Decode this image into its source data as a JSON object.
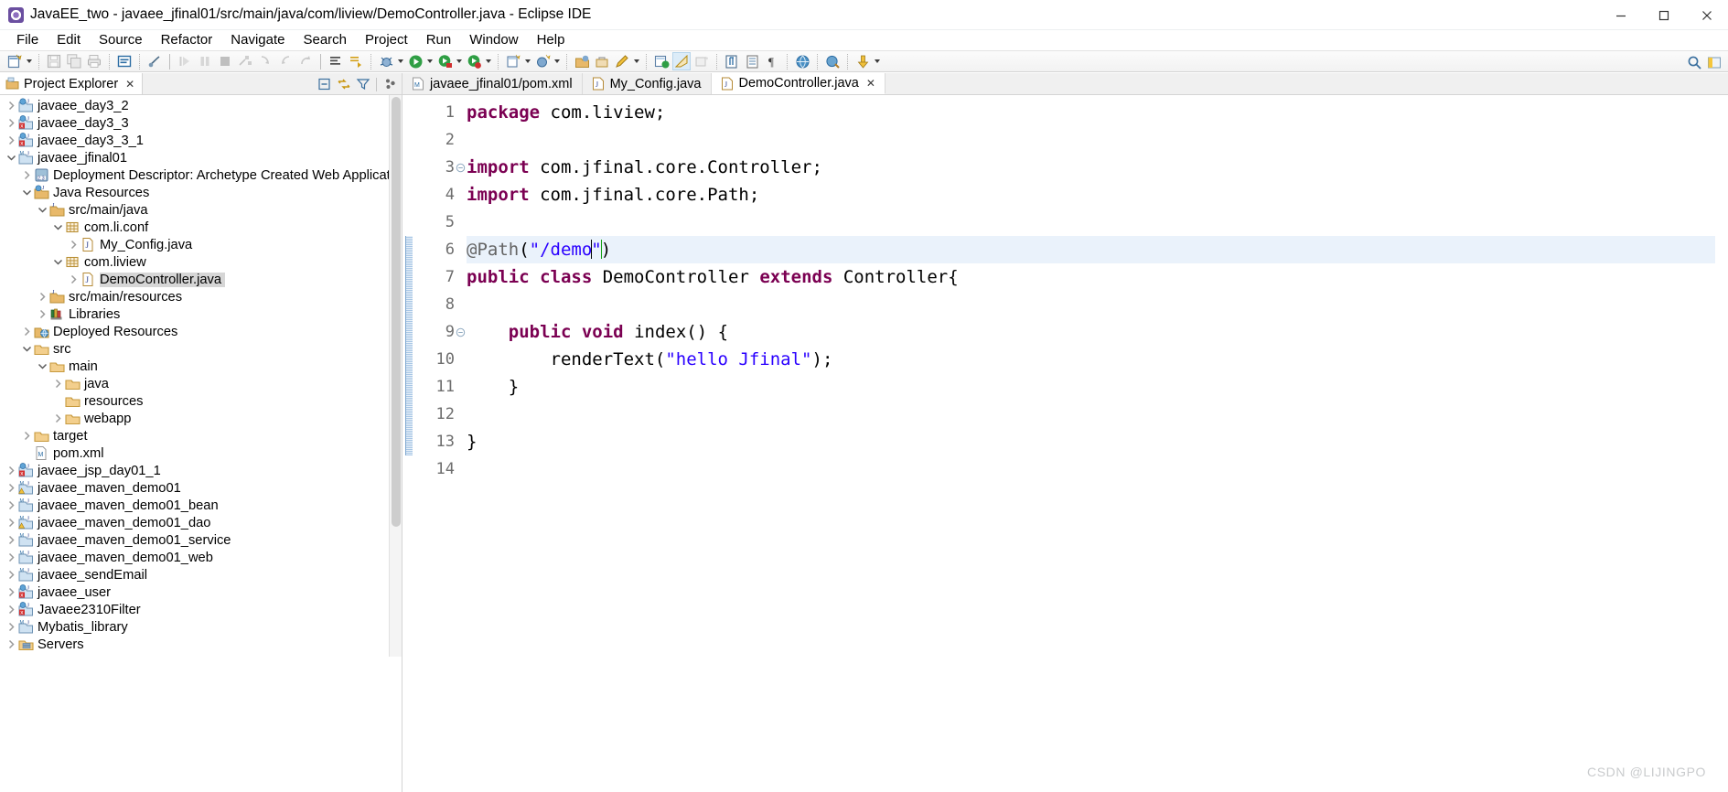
{
  "window": {
    "title": "JavaEE_two - javaee_jfinal01/src/main/java/com/liview/DemoController.java - Eclipse IDE",
    "app_icon": "eclipse-icon",
    "controls": {
      "minimize": "minimize-icon",
      "maximize": "maximize-icon",
      "close": "close-icon"
    }
  },
  "menubar": {
    "items": [
      {
        "label": "File"
      },
      {
        "label": "Edit"
      },
      {
        "label": "Source"
      },
      {
        "label": "Refactor"
      },
      {
        "label": "Navigate"
      },
      {
        "label": "Search"
      },
      {
        "label": "Project"
      },
      {
        "label": "Run"
      },
      {
        "label": "Window"
      },
      {
        "label": "Help"
      }
    ]
  },
  "toolbar": {
    "icons": [
      "new-wizard-icon",
      "save-icon",
      "save-all-icon",
      "print-icon",
      "toggle-mark-occurrences-icon",
      "link-with-editor-icon",
      "resume-icon",
      "suspend-icon",
      "terminate-icon",
      "disconnect-icon",
      "step-into-icon",
      "step-over-icon",
      "step-return-icon",
      "last-edit-location-icon",
      "next-annotation-icon",
      "debug-icon",
      "run-icon",
      "run-as-icon",
      "coverage-icon",
      "new-java-project-icon",
      "new-java-class-icon",
      "open-type-icon",
      "open-task-icon",
      "external-tools-icon",
      "search-icon",
      "pencil-icon",
      "build-icon",
      "java-browsing-icon",
      "java-perspective-icon",
      "pilcrow-icon",
      "web-browser-icon",
      "open-web-perspective-icon",
      "download-icon"
    ],
    "search_icon": "search-icon",
    "perspective_icon": "open-perspective-icon"
  },
  "project_explorer": {
    "tab_label": "Project Explorer",
    "tab_icon": "project-explorer-icon",
    "tab_close": "close-icon",
    "tools": [
      "collapse-all-icon",
      "link-with-editor-icon",
      "filter-icon",
      "view-menu-icon"
    ],
    "items": [
      {
        "label": "javaee_day3_2",
        "indent": 0,
        "twisty": "collapsed",
        "icon": "web-project-icon"
      },
      {
        "label": "javaee_day3_3",
        "indent": 0,
        "twisty": "collapsed",
        "icon": "web-project-error-icon"
      },
      {
        "label": "javaee_day3_3_1",
        "indent": 0,
        "twisty": "collapsed",
        "icon": "web-project-error-icon"
      },
      {
        "label": "javaee_jfinal01",
        "indent": 0,
        "twisty": "expanded",
        "icon": "maven-project-icon"
      },
      {
        "label": "Deployment Descriptor: Archetype Created Web Application",
        "indent": 1,
        "twisty": "collapsed",
        "icon": "deployment-descriptor-icon"
      },
      {
        "label": "Java Resources",
        "indent": 1,
        "twisty": "expanded",
        "icon": "java-resources-icon"
      },
      {
        "label": "src/main/java",
        "indent": 2,
        "twisty": "expanded",
        "icon": "source-folder-icon"
      },
      {
        "label": "com.li.conf",
        "indent": 3,
        "twisty": "expanded",
        "icon": "package-icon"
      },
      {
        "label": "My_Config.java",
        "indent": 4,
        "twisty": "collapsed",
        "icon": "java-file-icon"
      },
      {
        "label": "com.liview",
        "indent": 3,
        "twisty": "expanded",
        "icon": "package-icon"
      },
      {
        "label": "DemoController.java",
        "indent": 4,
        "twisty": "collapsed",
        "icon": "java-file-icon",
        "selected": true
      },
      {
        "label": "src/main/resources",
        "indent": 2,
        "twisty": "collapsed",
        "icon": "source-folder-icon"
      },
      {
        "label": "Libraries",
        "indent": 2,
        "twisty": "collapsed",
        "icon": "libraries-icon"
      },
      {
        "label": "Deployed Resources",
        "indent": 1,
        "twisty": "collapsed",
        "icon": "deployed-resources-icon"
      },
      {
        "label": "src",
        "indent": 1,
        "twisty": "expanded",
        "icon": "folder-icon"
      },
      {
        "label": "main",
        "indent": 2,
        "twisty": "expanded",
        "icon": "folder-icon"
      },
      {
        "label": "java",
        "indent": 3,
        "twisty": "collapsed",
        "icon": "folder-icon"
      },
      {
        "label": "resources",
        "indent": 3,
        "twisty": "none",
        "icon": "folder-icon"
      },
      {
        "label": "webapp",
        "indent": 3,
        "twisty": "collapsed",
        "icon": "folder-icon"
      },
      {
        "label": "target",
        "indent": 1,
        "twisty": "collapsed",
        "icon": "folder-icon"
      },
      {
        "label": "pom.xml",
        "indent": 1,
        "twisty": "none",
        "icon": "maven-pom-icon"
      },
      {
        "label": "javaee_jsp_day01_1",
        "indent": 0,
        "twisty": "collapsed",
        "icon": "web-project-error-icon"
      },
      {
        "label": "javaee_maven_demo01",
        "indent": 0,
        "twisty": "collapsed",
        "icon": "maven-project-warn-icon"
      },
      {
        "label": "javaee_maven_demo01_bean",
        "indent": 0,
        "twisty": "collapsed",
        "icon": "maven-project-icon"
      },
      {
        "label": "javaee_maven_demo01_dao",
        "indent": 0,
        "twisty": "collapsed",
        "icon": "maven-project-warn-icon"
      },
      {
        "label": "javaee_maven_demo01_service",
        "indent": 0,
        "twisty": "collapsed",
        "icon": "maven-project-icon"
      },
      {
        "label": "javaee_maven_demo01_web",
        "indent": 0,
        "twisty": "collapsed",
        "icon": "maven-project-icon"
      },
      {
        "label": "javaee_sendEmail",
        "indent": 0,
        "twisty": "collapsed",
        "icon": "maven-project-icon"
      },
      {
        "label": "javaee_user",
        "indent": 0,
        "twisty": "collapsed",
        "icon": "web-project-error-icon"
      },
      {
        "label": "Javaee2310Filter",
        "indent": 0,
        "twisty": "collapsed",
        "icon": "web-project-error-icon"
      },
      {
        "label": "Mybatis_library",
        "indent": 0,
        "twisty": "collapsed",
        "icon": "maven-project-icon"
      },
      {
        "label": "Servers",
        "indent": 0,
        "twisty": "collapsed",
        "icon": "servers-folder-icon"
      }
    ]
  },
  "editor": {
    "tabs": [
      {
        "label": "javaee_jfinal01/pom.xml",
        "icon": "maven-pom-icon",
        "active": false,
        "closable": false
      },
      {
        "label": "My_Config.java",
        "icon": "java-file-icon",
        "active": false,
        "closable": false
      },
      {
        "label": "DemoController.java",
        "icon": "java-file-icon",
        "active": true,
        "closable": true,
        "close_icon": "close-icon"
      }
    ],
    "line_numbers": [
      "1",
      "2",
      "3",
      "4",
      "5",
      "6",
      "7",
      "8",
      "9",
      "10",
      "11",
      "12",
      "13",
      "14"
    ],
    "fold_lines": [
      3,
      9
    ],
    "highlight_line": 6,
    "code_lines": [
      {
        "n": 1,
        "segments": [
          {
            "t": "package",
            "c": "kw"
          },
          {
            "t": " com.liview;",
            "c": ""
          }
        ]
      },
      {
        "n": 2,
        "segments": [
          {
            "t": "",
            "c": ""
          }
        ]
      },
      {
        "n": 3,
        "segments": [
          {
            "t": "import",
            "c": "kw"
          },
          {
            "t": " com.jfinal.core.Controller;",
            "c": ""
          }
        ]
      },
      {
        "n": 4,
        "segments": [
          {
            "t": "import",
            "c": "kw"
          },
          {
            "t": " com.jfinal.core.Path;",
            "c": ""
          }
        ]
      },
      {
        "n": 5,
        "segments": [
          {
            "t": "",
            "c": ""
          }
        ]
      },
      {
        "n": 6,
        "segments": [
          {
            "t": "@Path",
            "c": "annotated"
          },
          {
            "t": "(",
            "c": ""
          },
          {
            "t": "\"/demo",
            "c": "str"
          },
          {
            "t": "|CARET|",
            "c": "caret"
          },
          {
            "t": "\"",
            "c": "str"
          },
          {
            "t": "|CARET2|",
            "c": "caret2"
          },
          {
            "t": ")",
            "c": ""
          }
        ]
      },
      {
        "n": 7,
        "segments": [
          {
            "t": "public",
            "c": "kw"
          },
          {
            "t": " ",
            "c": ""
          },
          {
            "t": "class",
            "c": "kw"
          },
          {
            "t": " DemoController ",
            "c": ""
          },
          {
            "t": "extends",
            "c": "kw"
          },
          {
            "t": " Controller{",
            "c": ""
          }
        ]
      },
      {
        "n": 8,
        "segments": [
          {
            "t": "",
            "c": ""
          }
        ]
      },
      {
        "n": 9,
        "segments": [
          {
            "t": "    ",
            "c": ""
          },
          {
            "t": "public",
            "c": "kw"
          },
          {
            "t": " ",
            "c": ""
          },
          {
            "t": "void",
            "c": "kw"
          },
          {
            "t": " index() {",
            "c": ""
          }
        ]
      },
      {
        "n": 10,
        "segments": [
          {
            "t": "        renderText(",
            "c": ""
          },
          {
            "t": "\"hello Jfinal\"",
            "c": "str"
          },
          {
            "t": ");",
            "c": ""
          }
        ]
      },
      {
        "n": 11,
        "segments": [
          {
            "t": "    }",
            "c": ""
          }
        ]
      },
      {
        "n": 12,
        "segments": [
          {
            "t": "",
            "c": ""
          }
        ]
      },
      {
        "n": 13,
        "segments": [
          {
            "t": "}",
            "c": ""
          }
        ]
      },
      {
        "n": 14,
        "segments": [
          {
            "t": "",
            "c": ""
          }
        ]
      }
    ]
  },
  "watermark": {
    "text": "CSDN @LIJINGPO"
  },
  "colors": {
    "keyword": "#7b0052",
    "string": "#2a00ff",
    "annotation": "#646464",
    "highlight_line_bg": "#eaf2fb",
    "selection_bg": "#d6d6d6",
    "tab_active_bg": "#ffffff",
    "toolbar_bg": "#f2f2f2",
    "folder": "#e8b96a"
  }
}
